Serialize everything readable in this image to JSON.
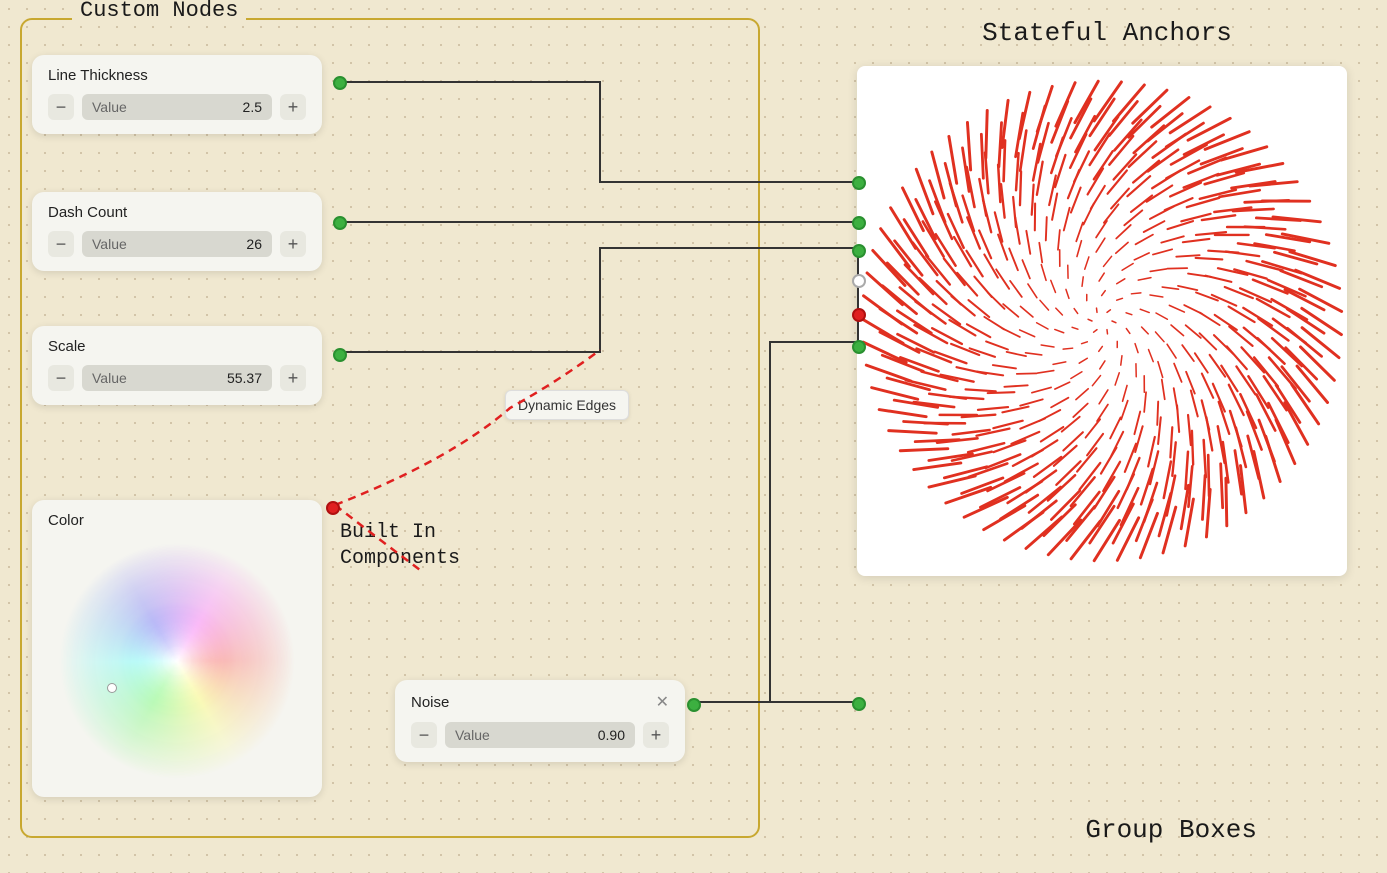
{
  "leftGroup": {
    "title": "Custom Nodes"
  },
  "lineThickness": {
    "title": "Line Thickness",
    "valueLabel": "Value",
    "value": "2.5",
    "minusLabel": "−",
    "plusLabel": "+"
  },
  "dashCount": {
    "title": "Dash Count",
    "valueLabel": "Value",
    "value": "26",
    "minusLabel": "−",
    "plusLabel": "+"
  },
  "scale": {
    "title": "Scale",
    "valueLabel": "Value",
    "value": "55.37",
    "minusLabel": "−",
    "plusLabel": "+"
  },
  "colorNode": {
    "title": "Color"
  },
  "noiseNode": {
    "title": "Noise",
    "closeLabel": "✕",
    "valueLabel": "Value",
    "value": "0.90",
    "minusLabel": "−",
    "plusLabel": "+"
  },
  "dynamicEdges": {
    "label": "Dynamic Edges"
  },
  "builtIn": {
    "line1": "Built In",
    "line2": "Components"
  },
  "statefulAnchors": {
    "title": "Stateful Anchors"
  },
  "groupBoxes": {
    "title": "Group Boxes"
  }
}
